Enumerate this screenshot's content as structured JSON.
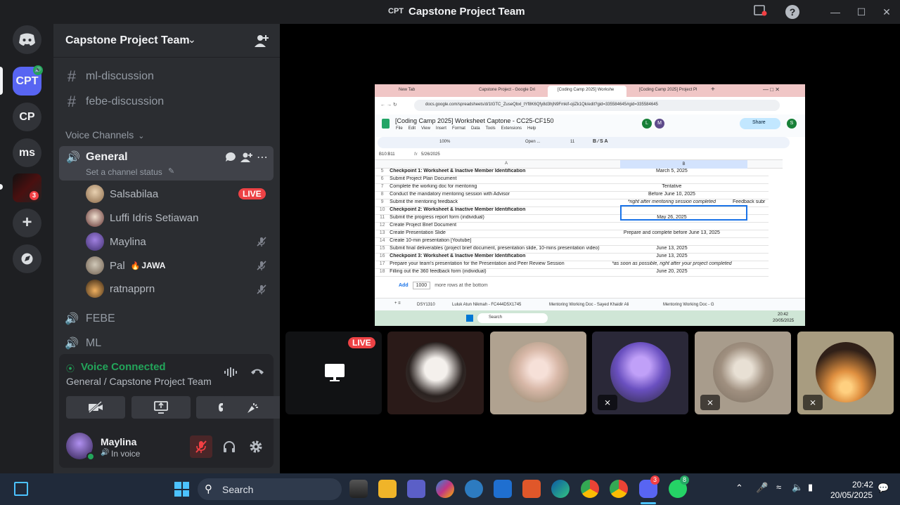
{
  "window": {
    "abbr": "CPT",
    "title": "Capstone Project Team"
  },
  "rail": {
    "servers": [
      {
        "label": "CPT"
      },
      {
        "label": "CP"
      },
      {
        "label": "ms"
      },
      {
        "label": "",
        "badge": "3"
      }
    ]
  },
  "sidebar": {
    "server_name": "Capstone Project Team",
    "text_channels": [
      "ml-discussion",
      "febe-discussion"
    ],
    "voice_header": "Voice Channels",
    "active_voice": {
      "name": "General",
      "status_placeholder": "Set a channel status"
    },
    "members": [
      {
        "name": "Salsabilaa",
        "live": "LIVE"
      },
      {
        "name": "Luffi Idris Setiawan"
      },
      {
        "name": "Maylina"
      },
      {
        "name": "Pal",
        "tag": "JAWA"
      },
      {
        "name": "ratnapprn"
      }
    ],
    "other_voice": [
      "FEBE",
      "ML"
    ]
  },
  "voice_panel": {
    "status": "Voice Connected",
    "location": "General / Capstone Project Team"
  },
  "user": {
    "name": "Maylina",
    "status": "In voice"
  },
  "stream": {
    "live_badge": "LIVE",
    "browser_tabs": [
      "New Tab",
      "Capstone Project - Google Dri",
      "[Coding Camp 2025] Workshe",
      "[Coding Camp 2025] Project Pl"
    ],
    "url": "docs.google.com/spreadsheets/d/1tGTC_ZuseQbxl_tYf8K6Qfy8d3hjN9Fmkif-ojiZk1Qk/edit?gid=335584645#gid=335584645",
    "doc_title": "[Coding Camp 2025] Worksheet Captone - CC25-CF150",
    "menus": [
      "File",
      "Edit",
      "View",
      "Insert",
      "Format",
      "Data",
      "Tools",
      "Extensions",
      "Help"
    ],
    "share_label": "Share",
    "zoom": "100%",
    "font": "Open ...",
    "font_size": "11",
    "cell_ref": "B10:B11",
    "formula": "5/26/2025",
    "rows": [
      {
        "num": "5",
        "a": "Checkpoint 1: Worksheet & Inactive Member Identification",
        "b": "March 5, 2025",
        "c": "",
        "bold": true
      },
      {
        "num": "6",
        "a": "Submit Project Plan Document",
        "b": "",
        "c": ""
      },
      {
        "num": "7",
        "a": "Complete the working doc for mentoring",
        "b": "Tentative",
        "c": ""
      },
      {
        "num": "8",
        "a": "Conduct the mandatory mentoring session with Advisor",
        "b": "Before June 10, 2025",
        "c": ""
      },
      {
        "num": "9",
        "a": "Submit the mentoring feedback",
        "b": "*right after mentoring session completed",
        "c": "Feedback subr",
        "ital": true
      },
      {
        "num": "10",
        "a": "Checkpoint 2: Worksheet & Inactive Member Identification",
        "b": "",
        "c": "",
        "bold": true
      },
      {
        "num": "11",
        "a": "Submit the progress report form (individual)",
        "b": "May 26, 2025",
        "c": ""
      },
      {
        "num": "12",
        "a": "Create Project Brief Document",
        "b": "",
        "c": ""
      },
      {
        "num": "13",
        "a": "Create Presentation Slide",
        "b": "Prepare and complete before June 13, 2025",
        "c": ""
      },
      {
        "num": "14",
        "a": "Create 10-min presentation [Youtube]",
        "b": "",
        "c": ""
      },
      {
        "num": "15",
        "a": "Submit final deliverables (project brief document, presentation slide, 10-mins presentation video)",
        "b": "June 13, 2025",
        "c": ""
      },
      {
        "num": "16",
        "a": "Checkpoint 3: Worksheet & Inactive Member Identification",
        "b": "June 13, 2025",
        "c": "",
        "bold": true
      },
      {
        "num": "17",
        "a": "Prepare your team's presentation for the Presentation and Peer Review Session",
        "b": "*as soon as possible, right after your project completed",
        "c": "",
        "ital": true
      },
      {
        "num": "18",
        "a": "Filling out the 360 feedback form (individual)",
        "b": "June 20, 2025",
        "c": ""
      }
    ],
    "add_label": "Add",
    "add_rows": "1000",
    "add_suffix": "more rows at the bottom",
    "sheet_tabs": [
      "DSY1310",
      "Luluk Atun Nikmah - FC444D5X1745",
      "Mentoring Working Doc - Sayed Khaidir Ali",
      "Mentoring Working Doc - G"
    ],
    "inner_search": "Search",
    "inner_time": "20:42",
    "inner_date": "20/05/2025"
  },
  "taskbar": {
    "search": "Search",
    "time": "20:42",
    "date": "20/05/2025",
    "discord_badge": "3",
    "whatsapp_badge": "8"
  },
  "colors": {
    "discord_blurple": "#5865f2",
    "live_red": "#ed4245",
    "voice_green": "#23a55a"
  }
}
